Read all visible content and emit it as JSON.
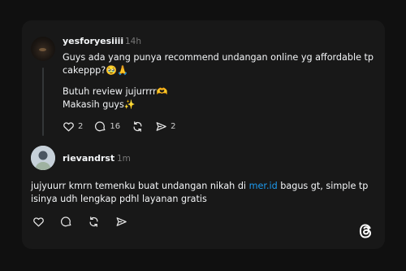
{
  "post1": {
    "username": "yesforyesiiii",
    "time": "14h",
    "line1": "Guys ada yang punya recommend undangan online yg affordable tp",
    "line2": "cakeppp?🥹🙏",
    "line3": "Butuh review jujurrrr🫶",
    "line4": "Makasih guys✨",
    "likes": "2",
    "comments": "16",
    "shares": "2"
  },
  "post2": {
    "username": "rievandrst",
    "time": "1m",
    "line1_before": "jujyuurr kmrn temenku buat undangan nikah di ",
    "line1_link": "mer.id",
    "line1_after": " bagus gt, simple tp",
    "line2": "isinya udh lengkap pdhl layanan gratis"
  },
  "icons": [
    "heart-icon",
    "comment-icon",
    "repost-icon",
    "share-icon",
    "threads-logo-icon"
  ],
  "colors": {
    "background": "#101010",
    "card": "#181818",
    "link": "#1d9bf0",
    "muted": "#777777"
  }
}
